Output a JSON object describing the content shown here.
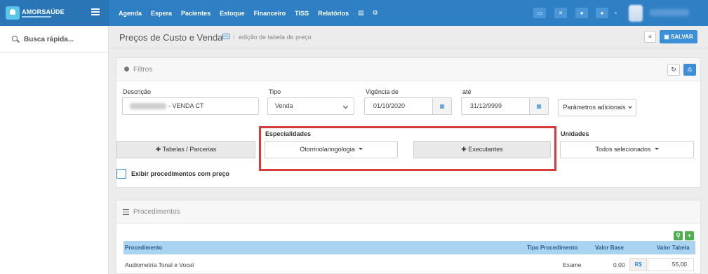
{
  "topbar": {
    "brand": "AMORSAÚDE",
    "nav": [
      "Agenda",
      "Espera",
      "Pacientes",
      "Estoque",
      "Financeiro",
      "TISS",
      "Relatórios"
    ]
  },
  "sidebar": {
    "search_placeholder": "Busca rápida..."
  },
  "header": {
    "title": "Preços de Custo e Venda",
    "breadcrumb": "edição de tabela de preço",
    "save_label": "SALVAR"
  },
  "filters": {
    "title": "Filtros",
    "descricao_label": "Descrição",
    "descricao_value": "- VENDA CT",
    "tipo_label": "Tipo",
    "tipo_value": "Venda",
    "vigencia_label": "Vigência de",
    "vigencia_value": "01/10/2020",
    "ate_label": "até",
    "ate_value": "31/12/9999",
    "parametros_label": "Parâmetros adicionais",
    "tabelas_label": "Tabelas / Parcerias",
    "especialidades_label": "Especialidades",
    "especialidades_value": "Otorrinolaringologia",
    "executantes_label": "Executantes",
    "unidades_label": "Unidades",
    "unidades_value": "Todos selecionados",
    "exibir_label": "Exibir procedimentos com preço"
  },
  "procedimentos": {
    "title": "Procedimentos",
    "columns": [
      "Procedimento",
      "Tipo Procedimento",
      "Valor Base",
      "Valor Tabela"
    ],
    "rows": [
      {
        "procedimento": "Audiometria Tonal e Vocal",
        "tipo": "Exame",
        "valor_base": "0,00",
        "currency": "R$",
        "valor_tabela": "55,00"
      }
    ]
  },
  "colors": {
    "topbar": "#2f7fc4",
    "primary": "#3a8fd6",
    "highlight": "#d63a3a",
    "table_header": "#a9d3f0"
  }
}
